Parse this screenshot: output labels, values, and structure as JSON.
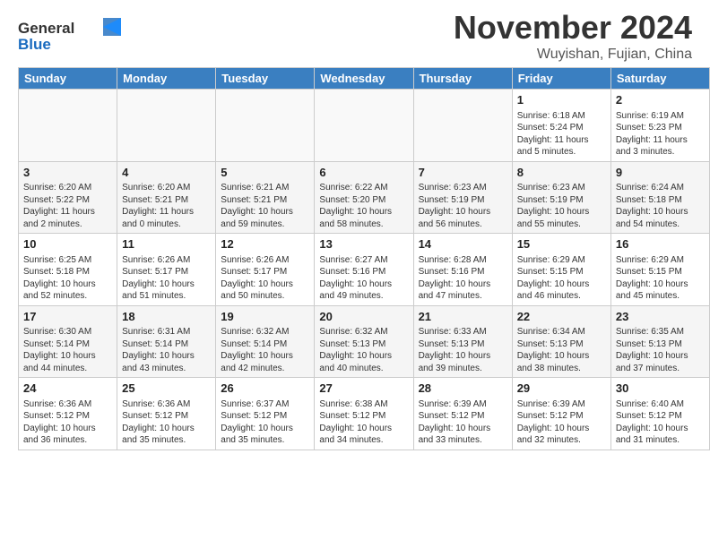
{
  "header": {
    "logo_general": "General",
    "logo_blue": "Blue",
    "month_title": "November 2024",
    "location": "Wuyishan, Fujian, China"
  },
  "days_of_week": [
    "Sunday",
    "Monday",
    "Tuesday",
    "Wednesday",
    "Thursday",
    "Friday",
    "Saturday"
  ],
  "weeks": [
    {
      "cells": [
        {
          "day": "",
          "empty": true
        },
        {
          "day": "",
          "empty": true
        },
        {
          "day": "",
          "empty": true
        },
        {
          "day": "",
          "empty": true
        },
        {
          "day": "",
          "empty": true
        },
        {
          "day": "1",
          "sunrise": "Sunrise: 6:18 AM",
          "sunset": "Sunset: 5:24 PM",
          "daylight": "Daylight: 11 hours and 5 minutes."
        },
        {
          "day": "2",
          "sunrise": "Sunrise: 6:19 AM",
          "sunset": "Sunset: 5:23 PM",
          "daylight": "Daylight: 11 hours and 3 minutes."
        }
      ]
    },
    {
      "cells": [
        {
          "day": "3",
          "sunrise": "Sunrise: 6:20 AM",
          "sunset": "Sunset: 5:22 PM",
          "daylight": "Daylight: 11 hours and 2 minutes."
        },
        {
          "day": "4",
          "sunrise": "Sunrise: 6:20 AM",
          "sunset": "Sunset: 5:21 PM",
          "daylight": "Daylight: 11 hours and 0 minutes."
        },
        {
          "day": "5",
          "sunrise": "Sunrise: 6:21 AM",
          "sunset": "Sunset: 5:21 PM",
          "daylight": "Daylight: 10 hours and 59 minutes."
        },
        {
          "day": "6",
          "sunrise": "Sunrise: 6:22 AM",
          "sunset": "Sunset: 5:20 PM",
          "daylight": "Daylight: 10 hours and 58 minutes."
        },
        {
          "day": "7",
          "sunrise": "Sunrise: 6:23 AM",
          "sunset": "Sunset: 5:19 PM",
          "daylight": "Daylight: 10 hours and 56 minutes."
        },
        {
          "day": "8",
          "sunrise": "Sunrise: 6:23 AM",
          "sunset": "Sunset: 5:19 PM",
          "daylight": "Daylight: 10 hours and 55 minutes."
        },
        {
          "day": "9",
          "sunrise": "Sunrise: 6:24 AM",
          "sunset": "Sunset: 5:18 PM",
          "daylight": "Daylight: 10 hours and 54 minutes."
        }
      ]
    },
    {
      "cells": [
        {
          "day": "10",
          "sunrise": "Sunrise: 6:25 AM",
          "sunset": "Sunset: 5:18 PM",
          "daylight": "Daylight: 10 hours and 52 minutes."
        },
        {
          "day": "11",
          "sunrise": "Sunrise: 6:26 AM",
          "sunset": "Sunset: 5:17 PM",
          "daylight": "Daylight: 10 hours and 51 minutes."
        },
        {
          "day": "12",
          "sunrise": "Sunrise: 6:26 AM",
          "sunset": "Sunset: 5:17 PM",
          "daylight": "Daylight: 10 hours and 50 minutes."
        },
        {
          "day": "13",
          "sunrise": "Sunrise: 6:27 AM",
          "sunset": "Sunset: 5:16 PM",
          "daylight": "Daylight: 10 hours and 49 minutes."
        },
        {
          "day": "14",
          "sunrise": "Sunrise: 6:28 AM",
          "sunset": "Sunset: 5:16 PM",
          "daylight": "Daylight: 10 hours and 47 minutes."
        },
        {
          "day": "15",
          "sunrise": "Sunrise: 6:29 AM",
          "sunset": "Sunset: 5:15 PM",
          "daylight": "Daylight: 10 hours and 46 minutes."
        },
        {
          "day": "16",
          "sunrise": "Sunrise: 6:29 AM",
          "sunset": "Sunset: 5:15 PM",
          "daylight": "Daylight: 10 hours and 45 minutes."
        }
      ]
    },
    {
      "cells": [
        {
          "day": "17",
          "sunrise": "Sunrise: 6:30 AM",
          "sunset": "Sunset: 5:14 PM",
          "daylight": "Daylight: 10 hours and 44 minutes."
        },
        {
          "day": "18",
          "sunrise": "Sunrise: 6:31 AM",
          "sunset": "Sunset: 5:14 PM",
          "daylight": "Daylight: 10 hours and 43 minutes."
        },
        {
          "day": "19",
          "sunrise": "Sunrise: 6:32 AM",
          "sunset": "Sunset: 5:14 PM",
          "daylight": "Daylight: 10 hours and 42 minutes."
        },
        {
          "day": "20",
          "sunrise": "Sunrise: 6:32 AM",
          "sunset": "Sunset: 5:13 PM",
          "daylight": "Daylight: 10 hours and 40 minutes."
        },
        {
          "day": "21",
          "sunrise": "Sunrise: 6:33 AM",
          "sunset": "Sunset: 5:13 PM",
          "daylight": "Daylight: 10 hours and 39 minutes."
        },
        {
          "day": "22",
          "sunrise": "Sunrise: 6:34 AM",
          "sunset": "Sunset: 5:13 PM",
          "daylight": "Daylight: 10 hours and 38 minutes."
        },
        {
          "day": "23",
          "sunrise": "Sunrise: 6:35 AM",
          "sunset": "Sunset: 5:13 PM",
          "daylight": "Daylight: 10 hours and 37 minutes."
        }
      ]
    },
    {
      "cells": [
        {
          "day": "24",
          "sunrise": "Sunrise: 6:36 AM",
          "sunset": "Sunset: 5:12 PM",
          "daylight": "Daylight: 10 hours and 36 minutes."
        },
        {
          "day": "25",
          "sunrise": "Sunrise: 6:36 AM",
          "sunset": "Sunset: 5:12 PM",
          "daylight": "Daylight: 10 hours and 35 minutes."
        },
        {
          "day": "26",
          "sunrise": "Sunrise: 6:37 AM",
          "sunset": "Sunset: 5:12 PM",
          "daylight": "Daylight: 10 hours and 35 minutes."
        },
        {
          "day": "27",
          "sunrise": "Sunrise: 6:38 AM",
          "sunset": "Sunset: 5:12 PM",
          "daylight": "Daylight: 10 hours and 34 minutes."
        },
        {
          "day": "28",
          "sunrise": "Sunrise: 6:39 AM",
          "sunset": "Sunset: 5:12 PM",
          "daylight": "Daylight: 10 hours and 33 minutes."
        },
        {
          "day": "29",
          "sunrise": "Sunrise: 6:39 AM",
          "sunset": "Sunset: 5:12 PM",
          "daylight": "Daylight: 10 hours and 32 minutes."
        },
        {
          "day": "30",
          "sunrise": "Sunrise: 6:40 AM",
          "sunset": "Sunset: 5:12 PM",
          "daylight": "Daylight: 10 hours and 31 minutes."
        }
      ]
    }
  ]
}
